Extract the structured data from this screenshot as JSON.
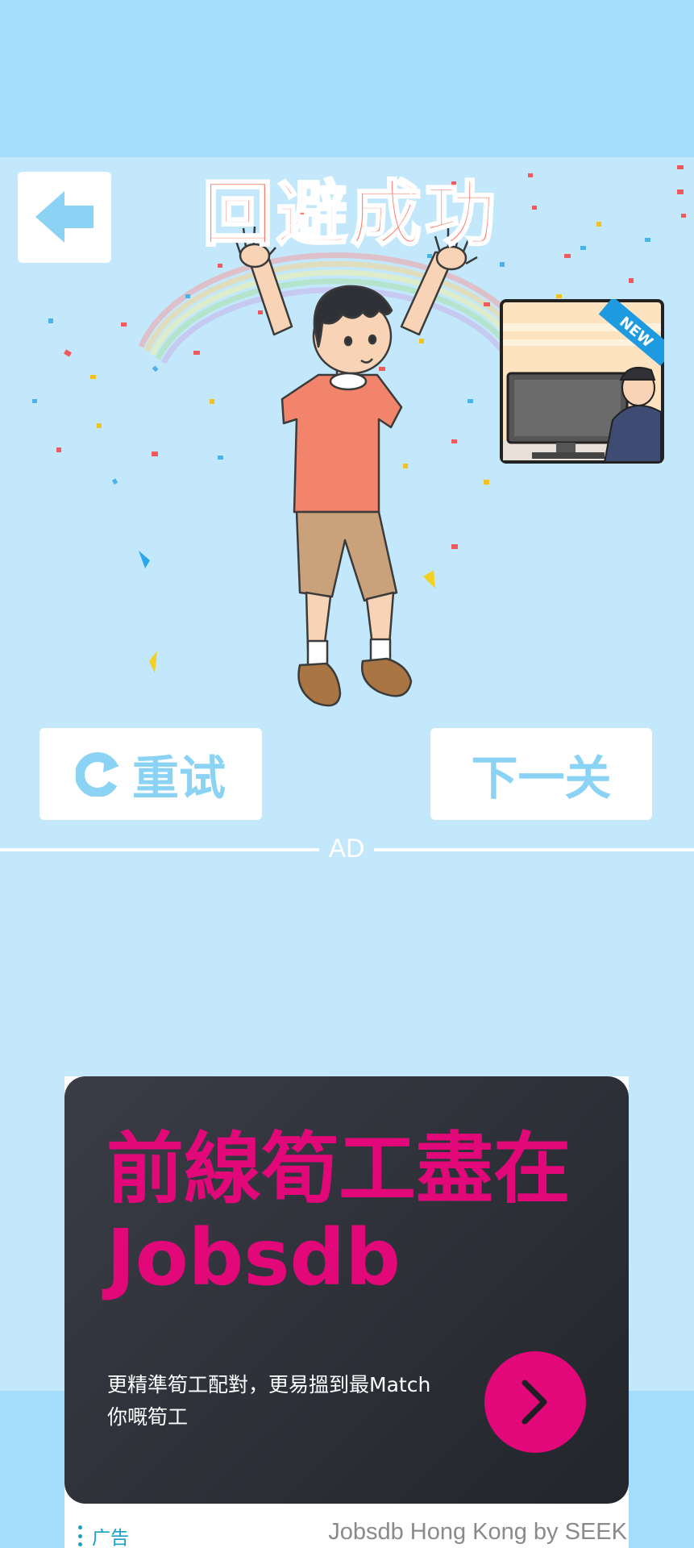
{
  "app": {
    "result_title": "回避成功",
    "back_icon": "arrow-left-icon",
    "promo_badge": "NEW"
  },
  "actions": {
    "retry_label": "重试",
    "retry_icon": "refresh-icon",
    "next_label": "下一关"
  },
  "ad": {
    "separator_label": "AD",
    "headline_line1": "前線筍工盡在",
    "headline_line2": "Jobsdb",
    "body": "更精準筍工配對，更易搵到最Match你嘅筍工",
    "cta_icon": "chevron-right-icon",
    "label": "广告",
    "advertiser": "Jobsdb Hong Kong by SEEK"
  },
  "colors": {
    "sky": "#c3e8fb",
    "band": "#a4dcfb",
    "title": "#f97e6e",
    "button_text": "#8ad3f4",
    "ad_bg": "#2a2c33",
    "ad_accent": "#e2087a"
  }
}
